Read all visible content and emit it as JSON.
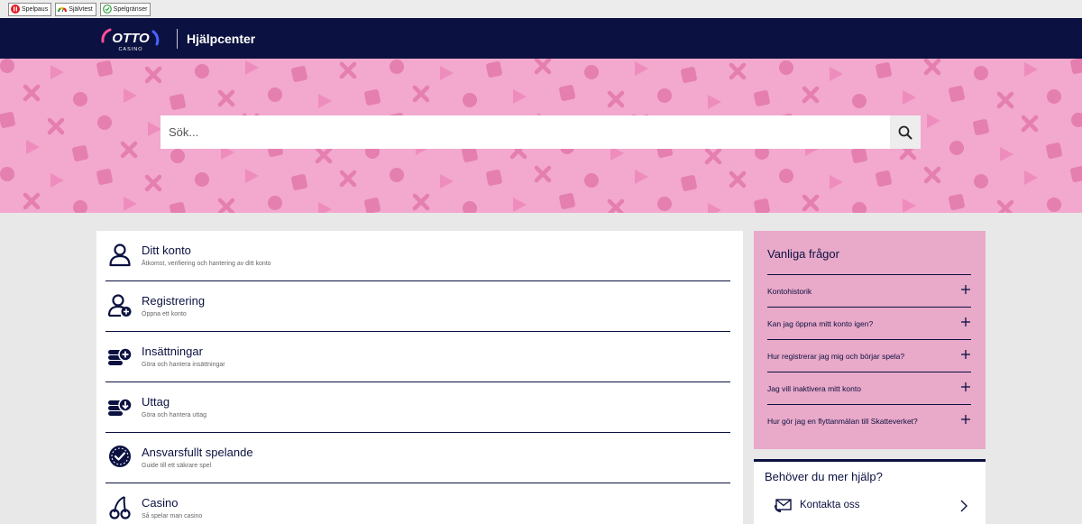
{
  "rg_bar": {
    "items": [
      {
        "label": "Spelpaus"
      },
      {
        "label": "Självtest"
      },
      {
        "label": "Spelgränser"
      }
    ]
  },
  "header": {
    "logo_text": "OTTO",
    "logo_subtext": "CASINO",
    "title": "Hjälpcenter"
  },
  "search": {
    "placeholder": "Sök..."
  },
  "categories": [
    {
      "title": "Ditt konto",
      "subtitle": "Åtkomst, verifiering och hantering av ditt konto",
      "icon": "user-icon"
    },
    {
      "title": "Registrering",
      "subtitle": "Öppna ett konto",
      "icon": "add-user-icon"
    },
    {
      "title": "Insättningar",
      "subtitle": "Göra och hantera insättningar",
      "icon": "coins-plus-icon"
    },
    {
      "title": "Uttag",
      "subtitle": "Göra och hantera uttag",
      "icon": "coins-download-icon"
    },
    {
      "title": "Ansvarsfullt spelande",
      "subtitle": "Guide till ett säkrare spel",
      "icon": "check-badge-icon"
    },
    {
      "title": "Casino",
      "subtitle": "Så spelar man casino",
      "icon": "cherries-icon"
    }
  ],
  "faq": {
    "title": "Vanliga frågor",
    "items": [
      {
        "question": "Kontohistorik"
      },
      {
        "question": "Kan jag öppna mitt konto igen?"
      },
      {
        "question": "Hur registrerar jag mig och börjar spela?"
      },
      {
        "question": "Jag vill inaktivera mitt konto"
      },
      {
        "question": "Hur gör jag en flyttanmälan till Skatteverket?"
      }
    ]
  },
  "help": {
    "title": "Behöver du mer hjälp?",
    "contact_label": "Kontakta oss"
  },
  "colors": {
    "navy": "#0b1140",
    "hero_pink": "#f3a8cd",
    "faq_pink": "#e9a9c9",
    "logo_accent": "#ff4f9a"
  }
}
